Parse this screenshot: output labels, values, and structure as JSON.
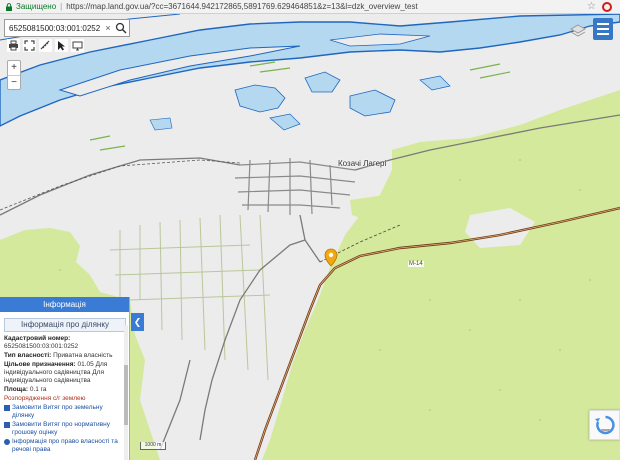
{
  "browser": {
    "secure_label": "Защищено",
    "separator": "|",
    "url": "https://map.land.gov.ua/?cc=3671644.942172865,5891769.629464851&z=13&l=dzk_overview_test"
  },
  "search": {
    "value": "6525081500:03:001:0252",
    "clear_label": "×"
  },
  "zoom": {
    "in_label": "+",
    "out_label": "−"
  },
  "map": {
    "place_label": "Козачі Лагері",
    "road_label": "М-14",
    "scale_label": "1000 m",
    "colors": {
      "water": "#b3d8f0",
      "river_bank": "#1f66bf",
      "forest": "#d4e99c",
      "land": "#ececec",
      "road_major": "#6b3a18",
      "road_minor": "#7a7a7a",
      "marker": "#f3a712"
    }
  },
  "panel": {
    "header": "Інформація",
    "subheader": "Інформація про ділянку",
    "cadastral_label": "Кадастровий номер:",
    "cadastral_value": "6525081500:03:001:0252",
    "ownership_label": "Тип власності:",
    "ownership_value": "Приватна власність",
    "purpose_label": "Цільове призначення:",
    "purpose_value": "01.05 Для індивідуального садівництва Для індивідуального садівництва",
    "area_label": "Площа:",
    "area_value": "0.1 га",
    "calc_link": "Розпорядження с/г землею",
    "link_extract": "Замовити Витяг про земельну ділянку",
    "link_valuation": "Замовити Витяг про нормативну грошову оцінку",
    "link_rights": "Інформація про право власності та речові права",
    "collapse_label": "❮"
  }
}
